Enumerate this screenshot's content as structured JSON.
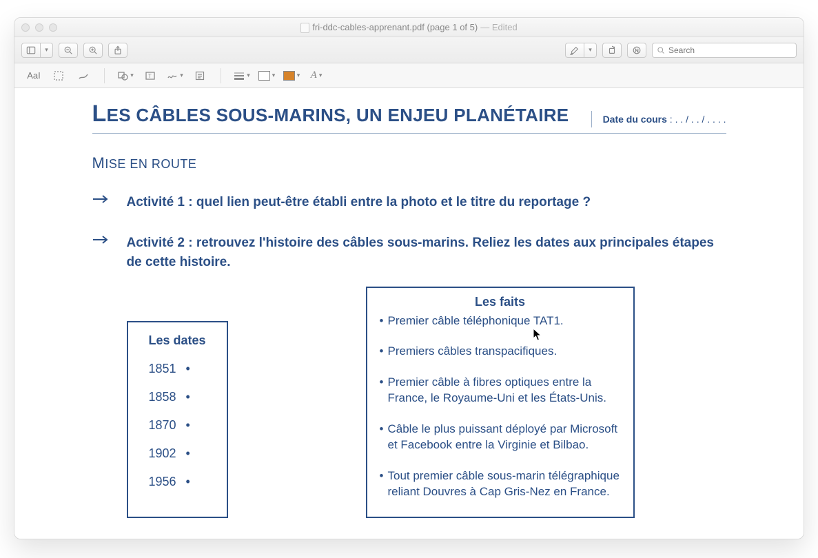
{
  "window": {
    "title": "fri-ddc-cables-apprenant.pdf (page 1 of 5)",
    "edited": "— Edited"
  },
  "toolbar": {
    "search_placeholder": "Search"
  },
  "markup": {
    "text_tool": "AaI",
    "font_style": "A"
  },
  "doc": {
    "title_cap": "L",
    "title_rest": "ES CÂBLES SOUS-MARINS, UN ENJEU PLANÉTAIRE",
    "date_label": "Date du cours",
    "date_value": " : . . / . . / . . . .",
    "section_cap": "M",
    "section_rest": "ISE EN ROUTE",
    "activity1": "Activité 1 : quel lien peut-être établi entre la photo et le titre du reportage ?",
    "activity2": "Activité 2 : retrouvez l'histoire des câbles sous-marins. Reliez les dates aux principales étapes de cette histoire.",
    "dates_heading": "Les dates",
    "dates": [
      "1851",
      "1858",
      "1870",
      "1902",
      "1956"
    ],
    "bullet": "•",
    "facts_heading": "Les faits",
    "facts": [
      "Premier câble téléphonique TAT1.",
      "Premiers câbles transpacifiques.",
      "Premier câble à fibres optiques entre la France, le Royaume-Uni et les États-Unis.",
      "Câble le plus puissant déployé par Microsoft et Facebook entre la Virginie et Bilbao.",
      "Tout premier câble sous-marin télégraphique reliant Douvres à Cap Gris-Nez en France."
    ]
  }
}
